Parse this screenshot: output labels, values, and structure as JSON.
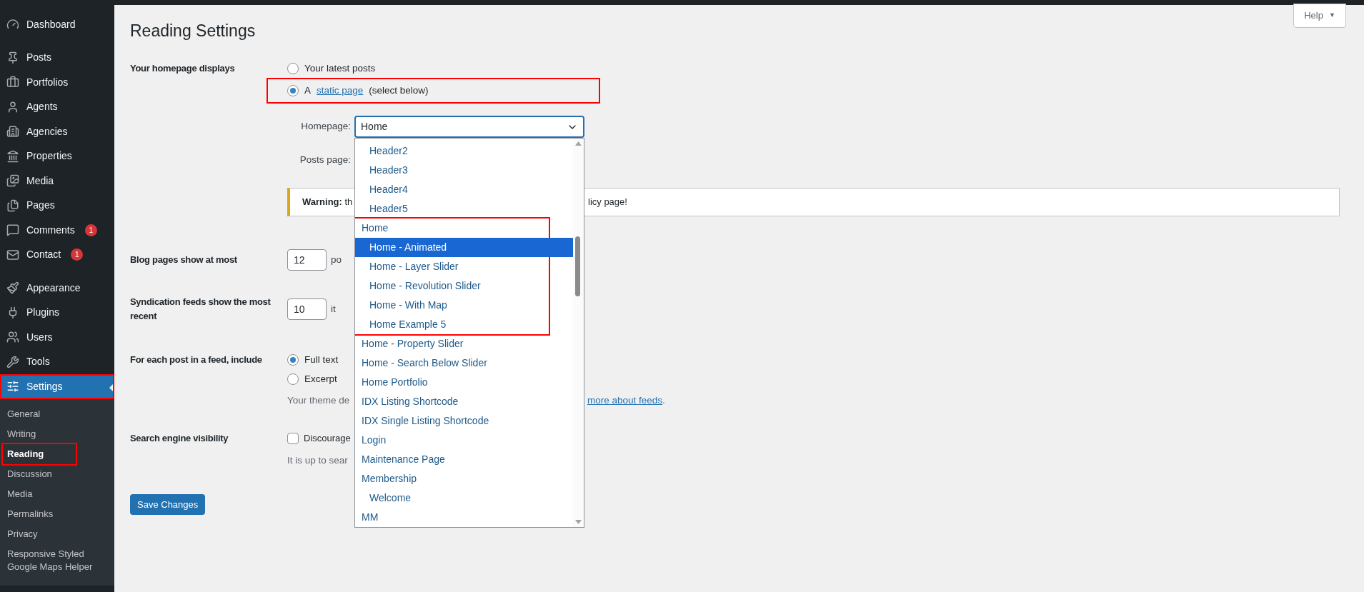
{
  "sidebar": {
    "groups": [
      [
        {
          "label": "Dashboard",
          "selected": false,
          "highlighted": false
        }
      ],
      [
        {
          "label": "Posts",
          "selected": false,
          "highlighted": false
        },
        {
          "label": "Portfolios",
          "selected": false,
          "highlighted": false
        },
        {
          "label": "Agents",
          "selected": false,
          "highlighted": false
        },
        {
          "label": "Agencies",
          "selected": false,
          "highlighted": false
        },
        {
          "label": "Properties",
          "selected": false,
          "highlighted": false
        },
        {
          "label": "Media",
          "selected": false,
          "highlighted": false
        },
        {
          "label": "Pages",
          "selected": false,
          "highlighted": false
        },
        {
          "label": "Comments",
          "badge": "1",
          "selected": false,
          "highlighted": false
        },
        {
          "label": "Contact",
          "badge": "1",
          "selected": false,
          "highlighted": false
        }
      ],
      [
        {
          "label": "Appearance",
          "selected": false,
          "highlighted": false
        },
        {
          "label": "Plugins",
          "selected": false,
          "highlighted": false
        },
        {
          "label": "Users",
          "selected": false,
          "highlighted": false
        },
        {
          "label": "Tools",
          "selected": false,
          "highlighted": false
        },
        {
          "label": "Settings",
          "selected": true,
          "highlighted": true
        }
      ]
    ],
    "submenu": [
      {
        "label": "General",
        "selected": false,
        "highlighted": false
      },
      {
        "label": "Writing",
        "selected": false,
        "highlighted": false
      },
      {
        "label": "Reading",
        "selected": true,
        "highlighted": true
      },
      {
        "label": "Discussion",
        "selected": false,
        "highlighted": false
      },
      {
        "label": "Media",
        "selected": false,
        "highlighted": false
      },
      {
        "label": "Permalinks",
        "selected": false,
        "highlighted": false
      },
      {
        "label": "Privacy",
        "selected": false,
        "highlighted": false
      },
      {
        "label": "Responsive Styled Google Maps Helper",
        "selected": false,
        "highlighted": false
      }
    ]
  },
  "help_button": {
    "label": "Help",
    "caret": "▼"
  },
  "title": "Reading Settings",
  "homepage_displays": {
    "label": "Your homepage displays",
    "options": [
      {
        "before": "Your latest posts",
        "selected": false,
        "highlighted": false
      },
      {
        "before": "A",
        "link": "static page",
        "after": "(select below)",
        "selected": true,
        "highlighted": true
      }
    ]
  },
  "homepage_select": {
    "label": "Homepage:",
    "value": "Home",
    "dropdown": {
      "continued_children": [
        {
          "label": "Header2",
          "selected": false
        },
        {
          "label": "Header3",
          "selected": false
        },
        {
          "label": "Header4",
          "selected": false
        },
        {
          "label": "Header5",
          "selected": false
        }
      ],
      "options": [
        {
          "label": "Home",
          "selected": false,
          "highlighted": true,
          "children": [
            {
              "label": "Home - Animated",
              "selected": true
            },
            {
              "label": "Home - Layer Slider",
              "selected": false
            },
            {
              "label": "Home - Revolution Slider",
              "selected": false
            },
            {
              "label": "Home - With Map",
              "selected": false
            },
            {
              "label": "Home Example 5",
              "selected": false
            }
          ]
        },
        {
          "label": "Home - Property Slider",
          "selected": false,
          "highlighted": false
        },
        {
          "label": "Home - Search Below Slider",
          "selected": false,
          "highlighted": false
        },
        {
          "label": "Home Portfolio",
          "selected": false,
          "highlighted": false
        },
        {
          "label": "IDX Listing Shortcode",
          "selected": false,
          "highlighted": false
        },
        {
          "label": "IDX Single Listing Shortcode",
          "selected": false,
          "highlighted": false
        },
        {
          "label": "Login",
          "selected": false,
          "highlighted": false
        },
        {
          "label": "Maintenance Page",
          "selected": false,
          "highlighted": false
        },
        {
          "label": "Membership",
          "selected": false,
          "highlighted": false,
          "children": [
            {
              "label": "Welcome",
              "selected": false
            }
          ]
        },
        {
          "label": "MM",
          "selected": false,
          "highlighted": false
        }
      ]
    }
  },
  "posts_page": {
    "label": "Posts page:"
  },
  "warning": {
    "left": "**Warning:** th",
    "right": "licy page!"
  },
  "blog_pages": {
    "label": "Blog pages show at most",
    "value": "12",
    "unit": "po"
  },
  "syndication": {
    "label": "Syndication feeds show the most recent",
    "value": "10",
    "unit": "it"
  },
  "feed_include": {
    "label": "For each post in a feed, include",
    "options": [
      {
        "label": "Full text",
        "selected": true
      },
      {
        "label": "Excerpt",
        "selected": false
      }
    ],
    "description": "Your theme de",
    "link": "more about feeds",
    "after_link": "."
  },
  "search_visibility": {
    "label": "Search engine visibility",
    "checkbox": {
      "label": "Discourage",
      "checked": false
    },
    "description": "It is up to sear"
  },
  "save_button": "Save Changes"
}
